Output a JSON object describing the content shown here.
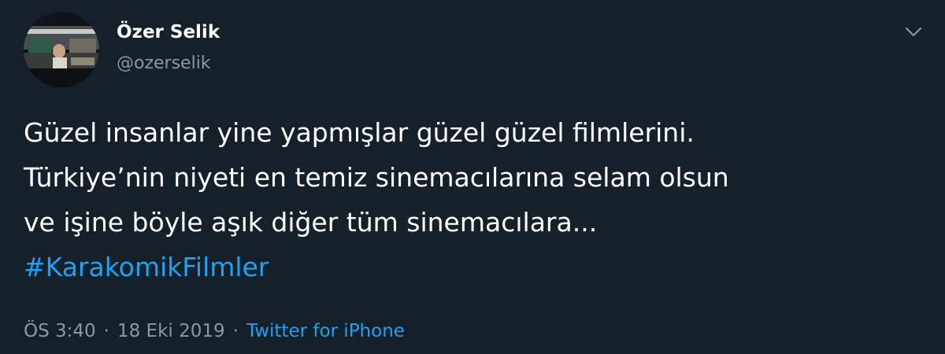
{
  "tweet": {
    "author": {
      "display_name": "Özer Selik",
      "handle": "@ozerselik"
    },
    "text_lines": [
      "Güzel insanlar yine yapmışlar güzel güzel filmlerini.",
      "Türkiye’nin niyeti en temiz sinemacılarına selam olsun",
      "ve işine böyle aşık diğer tüm sinemacılara..."
    ],
    "hashtag": "#KarakomikFilmler",
    "time": "ÖS 3:40",
    "separator": "·",
    "date": "18 Eki 2019",
    "source": "Twitter for iPhone"
  },
  "icons": {
    "menu": "chevron-down-icon"
  },
  "colors": {
    "background": "#15202b",
    "text": "#ffffff",
    "secondary_text": "#8899a6",
    "accent": "#1da1f2"
  }
}
